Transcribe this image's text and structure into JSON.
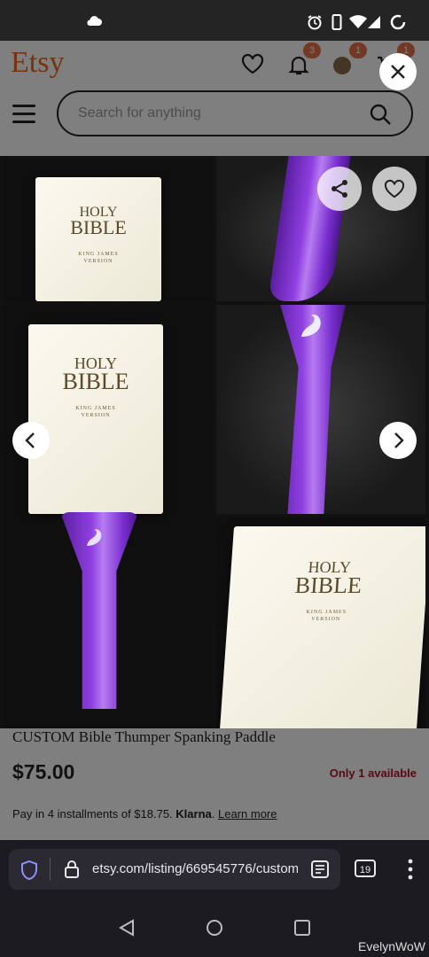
{
  "status_bar": {
    "icons": [
      "cloud-icon",
      "alarm-icon",
      "phone-icon",
      "wifi-icon",
      "signal-icon",
      "battery-icon"
    ]
  },
  "header": {
    "logo": "Etsy",
    "favorites_icon": "heart-icon",
    "notifications_badge": "3",
    "profile_badge": "1",
    "cart_badge": "1",
    "search_placeholder": "Search for anything"
  },
  "gallery": {
    "book_title_line1": "HOLY",
    "book_title_line2": "BIBLE",
    "book_subtitle_line1": "KING JAMES",
    "book_subtitle_line2": "VERSION",
    "actions": [
      "share-icon",
      "heart-icon",
      "close-icon",
      "chevron-left-icon",
      "chevron-right-icon"
    ]
  },
  "listing": {
    "title": "CUSTOM Bible Thumper Spanking Paddle",
    "price": "$75.00",
    "availability": "Only 1 available",
    "installments_text": "Pay in 4 installments of $18.75.",
    "klarna": "Klarna",
    "learn_more": "Learn more"
  },
  "browser": {
    "url": "etsy.com/listing/669545776/custom",
    "tab_count": "19"
  },
  "watermark": "EvelynWoW",
  "colors": {
    "brand": "#F1641E",
    "badge": "#e8734a",
    "availability": "#b3112e",
    "paddle_purple": "#8f3fe0"
  }
}
